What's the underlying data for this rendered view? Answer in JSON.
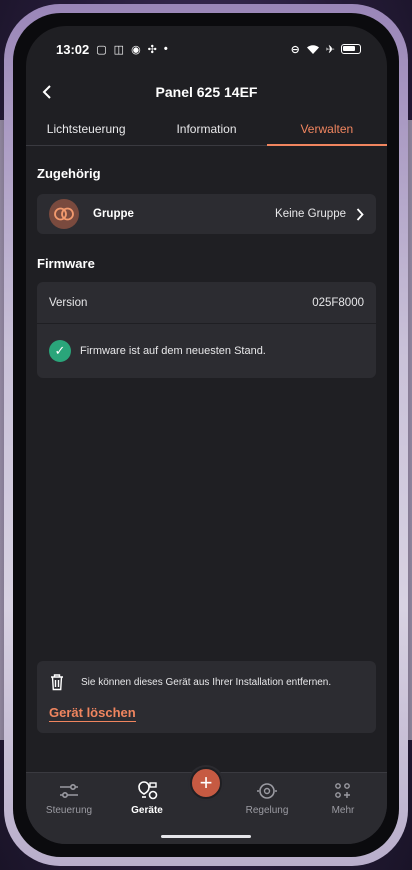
{
  "status_bar": {
    "time": "13:02"
  },
  "header": {
    "title": "Panel 625 14EF"
  },
  "tabs": [
    {
      "label": "Lichtsteuerung",
      "active": false
    },
    {
      "label": "Information",
      "active": false
    },
    {
      "label": "Verwalten",
      "active": true
    }
  ],
  "section_assoc": {
    "title": "Zugehörig"
  },
  "group": {
    "label": "Gruppe",
    "value": "Keine Gruppe"
  },
  "section_firmware": {
    "title": "Firmware"
  },
  "firmware": {
    "version_label": "Version",
    "version_value": "025F8000",
    "status_text": "Firmware ist auf dem neuesten Stand."
  },
  "delete": {
    "info_text": "Sie können dieses Gerät aus Ihrer Installation entfernen.",
    "link_label": "Gerät löschen"
  },
  "bottom_nav": {
    "items": [
      {
        "label": "Steuerung",
        "icon": "sliders-icon",
        "active": false
      },
      {
        "label": "Geräte",
        "icon": "devices-icon",
        "active": true
      },
      {
        "label": "Regelung",
        "icon": "sensor-icon",
        "active": false
      },
      {
        "label": "Mehr",
        "icon": "more-grid-icon",
        "active": false
      }
    ],
    "add_icon": "plus-icon"
  },
  "colors": {
    "accent": "#f0855f",
    "success": "#2aa57a",
    "background": "#1f1f23",
    "card": "#2c2c31"
  }
}
